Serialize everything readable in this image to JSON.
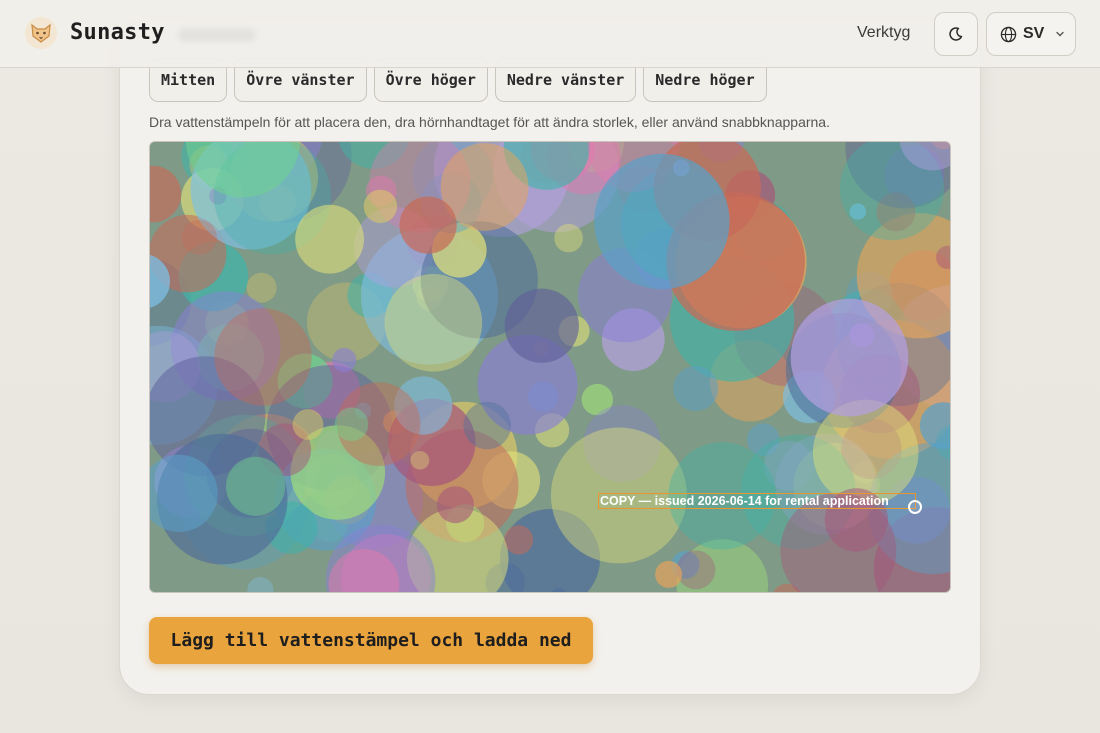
{
  "header": {
    "brand": "Sunasty",
    "tools_link": "Verktyg",
    "language": "SV",
    "icons": {
      "logo": "fox-logo-icon",
      "theme": "moon-icon",
      "language": "globe-icon",
      "dropdown": "chevron-down-icon"
    }
  },
  "editor": {
    "position_buttons": [
      "Mitten",
      "Övre vänster",
      "Övre höger",
      "Nedre vänster",
      "Nedre höger"
    ],
    "hint": "Dra vattenstämpeln för att placera den, dra hörnhandtaget för att ändra storlek, eller använd snabbknapparna.",
    "watermark_text": "COPY — issued 2026-06-14 for rental application",
    "submit_label": "Lägg till vattenstämpel och ladda ned"
  },
  "colors": {
    "accent": "#e9a43d",
    "selection": "#e8962e"
  }
}
